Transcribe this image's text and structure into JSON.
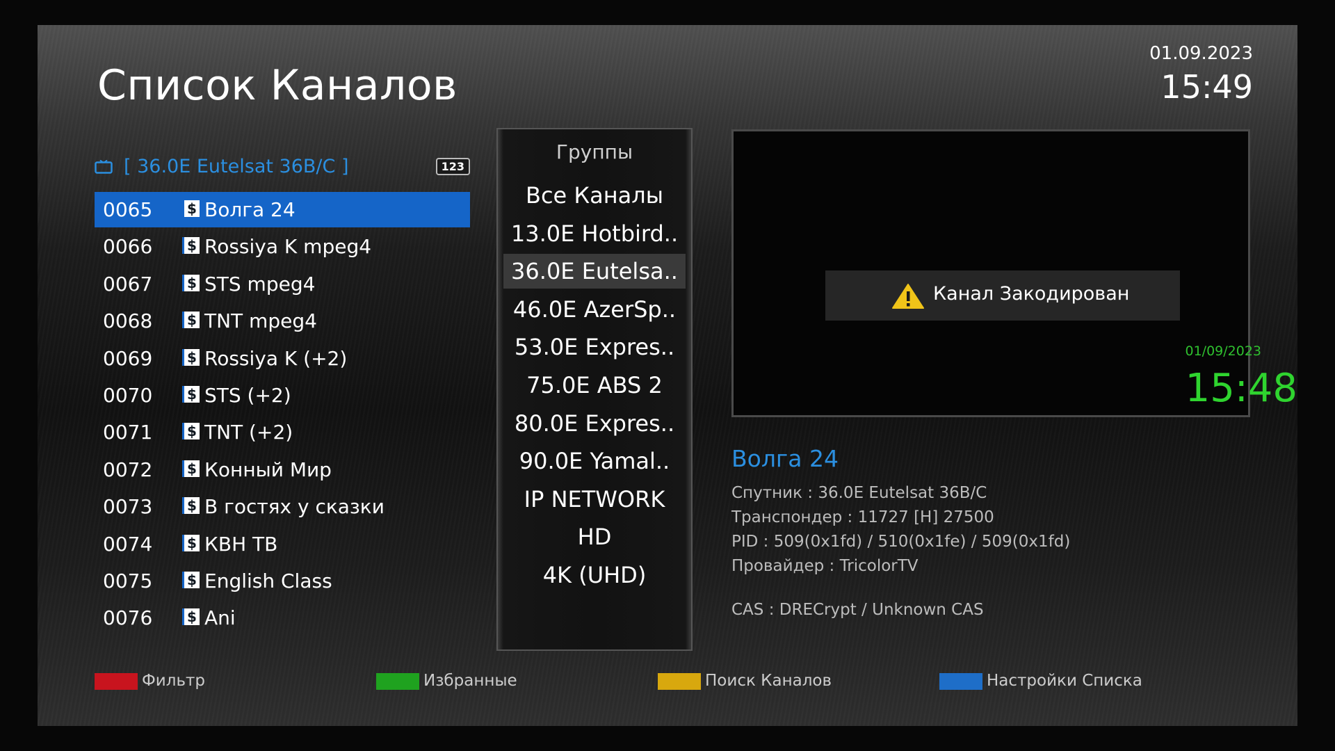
{
  "header": {
    "title": "Список Каналов",
    "date": "01.09.2023",
    "time": "15:49"
  },
  "channel_list": {
    "satellite_label": "[ 36.0E Eutelsat 36B/C ]",
    "count_badge": "123",
    "scrambled_marker": "$",
    "channels": [
      {
        "num": "0065",
        "name": "Волга 24",
        "selected": true
      },
      {
        "num": "0066",
        "name": "Rossiya K mpeg4"
      },
      {
        "num": "0067",
        "name": "STS mpeg4"
      },
      {
        "num": "0068",
        "name": "TNT mpeg4"
      },
      {
        "num": "0069",
        "name": "Rossiya K (+2)"
      },
      {
        "num": "0070",
        "name": "STS (+2)"
      },
      {
        "num": "0071",
        "name": "TNT (+2)"
      },
      {
        "num": "0072",
        "name": "Конный Мир"
      },
      {
        "num": "0073",
        "name": "В гостях у сказки"
      },
      {
        "num": "0074",
        "name": "КВН ТВ"
      },
      {
        "num": "0075",
        "name": "English Class"
      },
      {
        "num": "0076",
        "name": "Ani"
      }
    ]
  },
  "groups": {
    "title": "Группы",
    "items": [
      {
        "label": "Все Каналы"
      },
      {
        "label": "13.0E Hotbird.."
      },
      {
        "label": "36.0E Eutelsa..",
        "active": true
      },
      {
        "label": "46.0E AzerSp.."
      },
      {
        "label": "53.0E Expres.."
      },
      {
        "label": "75.0E ABS 2"
      },
      {
        "label": "80.0E Expres.."
      },
      {
        "label": "90.0E Yamal.."
      },
      {
        "label": "IP NETWORK"
      },
      {
        "label": "HD"
      },
      {
        "label": "4K (UHD)"
      }
    ]
  },
  "preview": {
    "scrambled_text": "Канал Закодирован",
    "overlay_date": "01/09/2023",
    "overlay_time": "15:48"
  },
  "info": {
    "channel_name": "Волга 24",
    "satellite": "Спутник : 36.0E Eutelsat 36B/C",
    "transponder": "Транспондер : 11727 [H] 27500",
    "pid": "PID : 509(0x1fd) / 510(0x1fe) / 509(0x1fd)",
    "provider": "Провайдер : TricolorTV",
    "cas": "CAS : DRECrypt / Unknown CAS"
  },
  "footer": {
    "keys": [
      {
        "label": "Фильтр",
        "color": "#c8141e"
      },
      {
        "label": "Избранные",
        "color": "#1fa21f"
      },
      {
        "label": "Поиск Каналов",
        "color": "#d8a80e"
      },
      {
        "label": "Настройки Списка",
        "color": "#1e6ec8"
      }
    ]
  },
  "colors": {
    "accent": "#2b8fe0",
    "selection": "#1565c8",
    "record_green": "#2fd42f"
  }
}
